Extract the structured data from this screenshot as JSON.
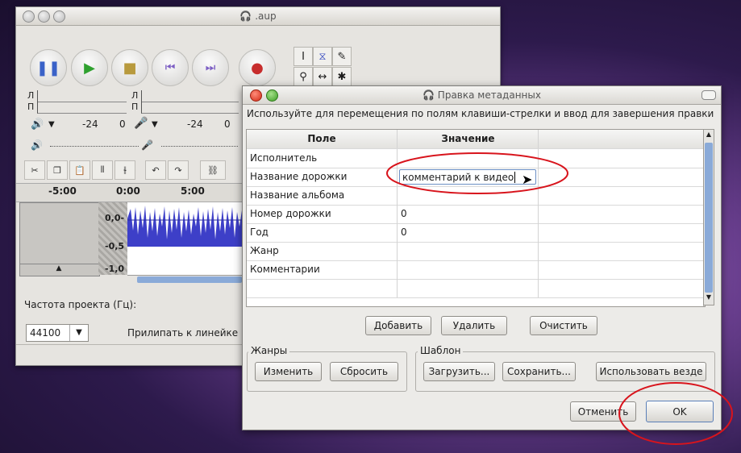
{
  "colors": {
    "annotation_red": "#d8141c",
    "dialog_accent_blue": "#8aaad8",
    "waveform": "#3d3fc8"
  },
  "audacity": {
    "title": ".aup",
    "meter": {
      "left": "Л",
      "right": "П",
      "db1": "-24",
      "zero1": "0",
      "db2": "-24",
      "zero2": "0"
    },
    "timeline": {
      "t1": "-5:00",
      "t2": "0:00",
      "t3": "5:00"
    },
    "scale": {
      "v1": "0,0-",
      "v2": "-0,5",
      "v3": "-1,0"
    },
    "project_rate_label": "Частота проекта (Гц):",
    "project_rate_value": "44100",
    "snap_label": "Прилипать к линейке"
  },
  "dialog": {
    "title": "Правка метаданных",
    "hint": "Используйте для перемещения по полям клавиши-стрелки и ввод для завершения правки",
    "col_field": "Поле",
    "col_value": "Значение",
    "rows": [
      {
        "field": "Исполнитель",
        "value": ""
      },
      {
        "field": "Название дорожки",
        "value": "комментарий к видео"
      },
      {
        "field": "Название альбома",
        "value": ""
      },
      {
        "field": "Номер дорожки",
        "value": "0"
      },
      {
        "field": "Год",
        "value": "0"
      },
      {
        "field": "Жанр",
        "value": ""
      },
      {
        "field": "Комментарии",
        "value": ""
      }
    ],
    "btn_add": "Добавить",
    "btn_remove": "Удалить",
    "btn_clear": "Очистить",
    "genres_label": "Жанры",
    "btn_edit": "Изменить",
    "btn_reset": "Сбросить",
    "template_label": "Шаблон",
    "btn_load": "Загрузить...",
    "btn_save": "Сохранить...",
    "btn_use_everywhere": "Использовать везде",
    "btn_cancel": "Отменить",
    "btn_ok": "OK"
  }
}
